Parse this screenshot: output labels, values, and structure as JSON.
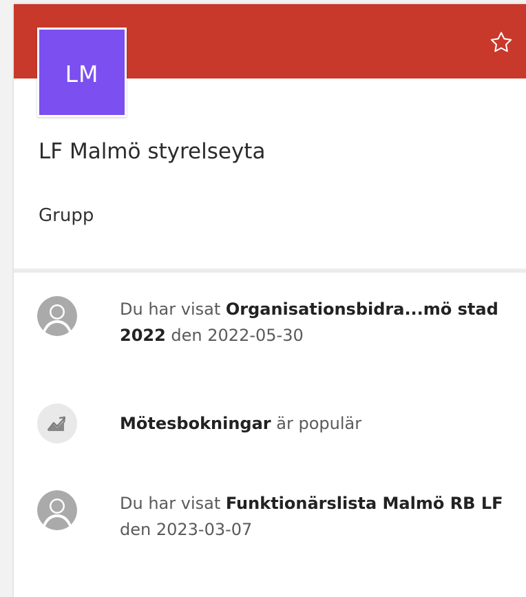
{
  "site": {
    "initials": "LM",
    "title": "LF Malmö styrelseyta",
    "type": "Grupp",
    "banner_color": "#c8392b",
    "logo_color": "#7b4ff0",
    "follow_icon": "star-outline-icon"
  },
  "activities": [
    {
      "icon": "person-avatar-icon",
      "prefix": "Du har visat ",
      "item": "Organisationsbidra...mö stad 2022",
      "suffix": " den 2022-05-30"
    },
    {
      "icon": "trending-icon",
      "prefix": "",
      "item": "Mötesbokningar",
      "suffix": " är populär"
    },
    {
      "icon": "person-avatar-icon",
      "prefix": "Du har visat ",
      "item": "Funktionärslista Malmö RB LF",
      "suffix": " den 2023-03-07"
    }
  ]
}
